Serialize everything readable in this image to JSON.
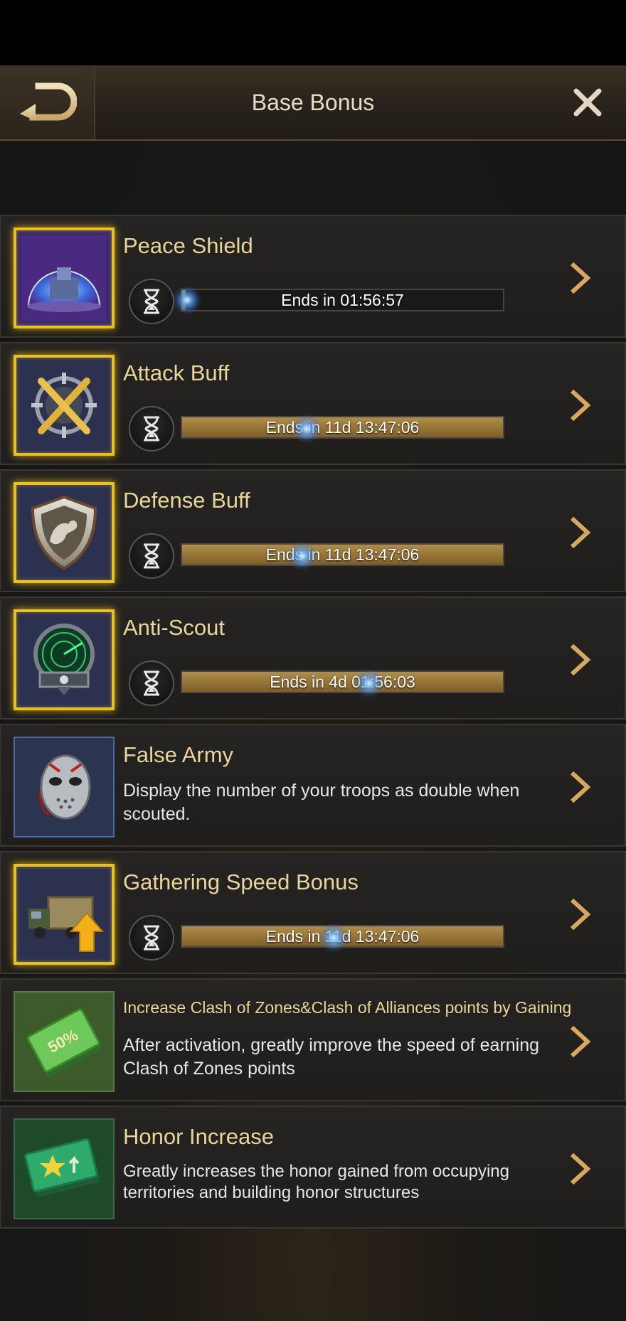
{
  "header": {
    "title": "Base Bonus",
    "back_icon": "back-arrow-icon",
    "close_icon": "close-icon"
  },
  "items": [
    {
      "title": "Peace Shield",
      "icon": "peace-shield-icon",
      "active": true,
      "timer_text": "Ends in 01:56:57",
      "progress": 0.01
    },
    {
      "title": "Attack Buff",
      "icon": "attack-buff-icon",
      "active": true,
      "timer_text": "Ends in 11d 13:47:06",
      "progress": 1.0
    },
    {
      "title": "Defense Buff",
      "icon": "defense-buff-icon",
      "active": true,
      "timer_text": "Ends in 11d 13:47:06",
      "progress": 1.0
    },
    {
      "title": "Anti-Scout",
      "icon": "anti-scout-icon",
      "active": true,
      "timer_text": "Ends in 4d 01:56:03",
      "progress": 1.0
    },
    {
      "title": "False Army",
      "icon": "false-army-mask-icon",
      "active": false,
      "description": "Display the number of your troops as double when scouted."
    },
    {
      "title": "Gathering Speed Bonus",
      "icon": "gathering-truck-icon",
      "active": true,
      "timer_text": "Ends in 11d 13:47:06",
      "progress": 1.0
    },
    {
      "title": "Increase Clash of Zones&Clash of Alliances points by Gaining",
      "icon": "clash-points-ticket-icon",
      "active": false,
      "description": "After activation, greatly improve the speed of earning Clash of Zones points"
    },
    {
      "title": "Honor Increase",
      "icon": "honor-ticket-icon",
      "active": false,
      "description": "Greatly increases the honor gained from occupying territories and building honor structures"
    }
  ],
  "colors": {
    "title_gold": "#e9d59a",
    "active_frame": "#e8c020",
    "bar_fill": "#957336",
    "arrow": "#d9a860"
  }
}
